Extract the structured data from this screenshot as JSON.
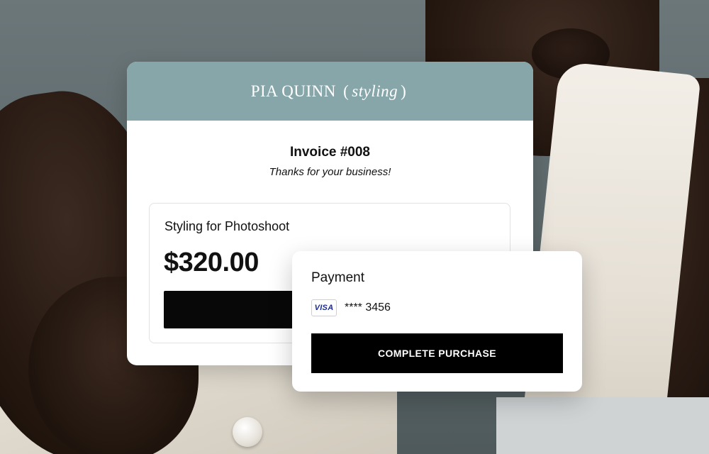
{
  "invoice": {
    "brand_name": "PIA QUINN",
    "brand_open_paren": "(",
    "brand_tagline": "styling",
    "brand_close_paren": ")",
    "title": "Invoice #008",
    "subtitle": "Thanks for your business!",
    "item_title": "Styling for Photoshoot",
    "amount": "$320.00"
  },
  "payment": {
    "title": "Payment",
    "card_brand": "VISA",
    "card_number": "**** 3456",
    "complete_label": "COMPLETE PURCHASE"
  },
  "colors": {
    "header_bg": "#86a6aa",
    "button_bg": "#000000",
    "visa_blue": "#1a2a8c"
  }
}
